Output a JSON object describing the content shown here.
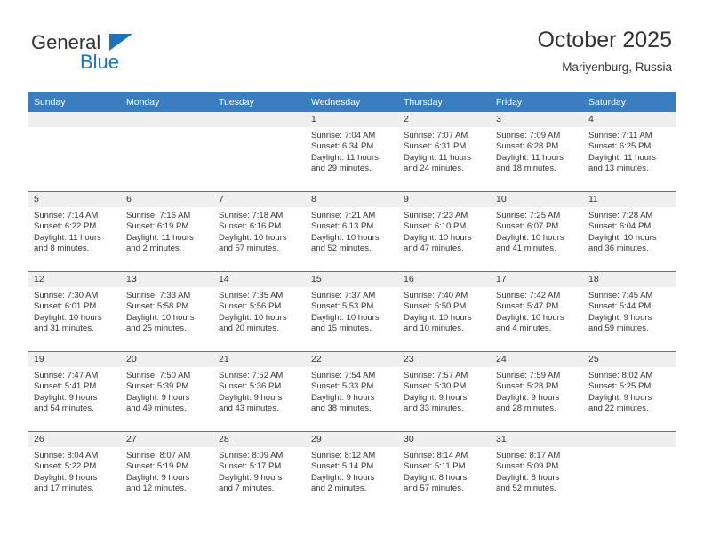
{
  "brand": {
    "name_top": "General",
    "name_bottom": "Blue",
    "accent_color": "#1b72bd",
    "triangle_icon": "triangle-right-icon"
  },
  "header": {
    "title": "October 2025",
    "subtitle": "Mariyenburg, Russia"
  },
  "theme": {
    "header_row_bg": "#3a7ebf",
    "daynum_band_bg": "#efefef",
    "text_color": "#333333",
    "row_divider": "#3a7ebf"
  },
  "weekdays": [
    "Sunday",
    "Monday",
    "Tuesday",
    "Wednesday",
    "Thursday",
    "Friday",
    "Saturday"
  ],
  "weeks": [
    [
      {
        "empty": true
      },
      {
        "empty": true
      },
      {
        "empty": true
      },
      {
        "day": "1",
        "sunrise": "Sunrise: 7:04 AM",
        "sunset": "Sunset: 6:34 PM",
        "daylight1": "Daylight: 11 hours",
        "daylight2": "and 29 minutes."
      },
      {
        "day": "2",
        "sunrise": "Sunrise: 7:07 AM",
        "sunset": "Sunset: 6:31 PM",
        "daylight1": "Daylight: 11 hours",
        "daylight2": "and 24 minutes."
      },
      {
        "day": "3",
        "sunrise": "Sunrise: 7:09 AM",
        "sunset": "Sunset: 6:28 PM",
        "daylight1": "Daylight: 11 hours",
        "daylight2": "and 18 minutes."
      },
      {
        "day": "4",
        "sunrise": "Sunrise: 7:11 AM",
        "sunset": "Sunset: 6:25 PM",
        "daylight1": "Daylight: 11 hours",
        "daylight2": "and 13 minutes."
      }
    ],
    [
      {
        "day": "5",
        "sunrise": "Sunrise: 7:14 AM",
        "sunset": "Sunset: 6:22 PM",
        "daylight1": "Daylight: 11 hours",
        "daylight2": "and 8 minutes."
      },
      {
        "day": "6",
        "sunrise": "Sunrise: 7:16 AM",
        "sunset": "Sunset: 6:19 PM",
        "daylight1": "Daylight: 11 hours",
        "daylight2": "and 2 minutes."
      },
      {
        "day": "7",
        "sunrise": "Sunrise: 7:18 AM",
        "sunset": "Sunset: 6:16 PM",
        "daylight1": "Daylight: 10 hours",
        "daylight2": "and 57 minutes."
      },
      {
        "day": "8",
        "sunrise": "Sunrise: 7:21 AM",
        "sunset": "Sunset: 6:13 PM",
        "daylight1": "Daylight: 10 hours",
        "daylight2": "and 52 minutes."
      },
      {
        "day": "9",
        "sunrise": "Sunrise: 7:23 AM",
        "sunset": "Sunset: 6:10 PM",
        "daylight1": "Daylight: 10 hours",
        "daylight2": "and 47 minutes."
      },
      {
        "day": "10",
        "sunrise": "Sunrise: 7:25 AM",
        "sunset": "Sunset: 6:07 PM",
        "daylight1": "Daylight: 10 hours",
        "daylight2": "and 41 minutes."
      },
      {
        "day": "11",
        "sunrise": "Sunrise: 7:28 AM",
        "sunset": "Sunset: 6:04 PM",
        "daylight1": "Daylight: 10 hours",
        "daylight2": "and 36 minutes."
      }
    ],
    [
      {
        "day": "12",
        "sunrise": "Sunrise: 7:30 AM",
        "sunset": "Sunset: 6:01 PM",
        "daylight1": "Daylight: 10 hours",
        "daylight2": "and 31 minutes."
      },
      {
        "day": "13",
        "sunrise": "Sunrise: 7:33 AM",
        "sunset": "Sunset: 5:58 PM",
        "daylight1": "Daylight: 10 hours",
        "daylight2": "and 25 minutes."
      },
      {
        "day": "14",
        "sunrise": "Sunrise: 7:35 AM",
        "sunset": "Sunset: 5:56 PM",
        "daylight1": "Daylight: 10 hours",
        "daylight2": "and 20 minutes."
      },
      {
        "day": "15",
        "sunrise": "Sunrise: 7:37 AM",
        "sunset": "Sunset: 5:53 PM",
        "daylight1": "Daylight: 10 hours",
        "daylight2": "and 15 minutes."
      },
      {
        "day": "16",
        "sunrise": "Sunrise: 7:40 AM",
        "sunset": "Sunset: 5:50 PM",
        "daylight1": "Daylight: 10 hours",
        "daylight2": "and 10 minutes."
      },
      {
        "day": "17",
        "sunrise": "Sunrise: 7:42 AM",
        "sunset": "Sunset: 5:47 PM",
        "daylight1": "Daylight: 10 hours",
        "daylight2": "and 4 minutes."
      },
      {
        "day": "18",
        "sunrise": "Sunrise: 7:45 AM",
        "sunset": "Sunset: 5:44 PM",
        "daylight1": "Daylight: 9 hours",
        "daylight2": "and 59 minutes."
      }
    ],
    [
      {
        "day": "19",
        "sunrise": "Sunrise: 7:47 AM",
        "sunset": "Sunset: 5:41 PM",
        "daylight1": "Daylight: 9 hours",
        "daylight2": "and 54 minutes."
      },
      {
        "day": "20",
        "sunrise": "Sunrise: 7:50 AM",
        "sunset": "Sunset: 5:39 PM",
        "daylight1": "Daylight: 9 hours",
        "daylight2": "and 49 minutes."
      },
      {
        "day": "21",
        "sunrise": "Sunrise: 7:52 AM",
        "sunset": "Sunset: 5:36 PM",
        "daylight1": "Daylight: 9 hours",
        "daylight2": "and 43 minutes."
      },
      {
        "day": "22",
        "sunrise": "Sunrise: 7:54 AM",
        "sunset": "Sunset: 5:33 PM",
        "daylight1": "Daylight: 9 hours",
        "daylight2": "and 38 minutes."
      },
      {
        "day": "23",
        "sunrise": "Sunrise: 7:57 AM",
        "sunset": "Sunset: 5:30 PM",
        "daylight1": "Daylight: 9 hours",
        "daylight2": "and 33 minutes."
      },
      {
        "day": "24",
        "sunrise": "Sunrise: 7:59 AM",
        "sunset": "Sunset: 5:28 PM",
        "daylight1": "Daylight: 9 hours",
        "daylight2": "and 28 minutes."
      },
      {
        "day": "25",
        "sunrise": "Sunrise: 8:02 AM",
        "sunset": "Sunset: 5:25 PM",
        "daylight1": "Daylight: 9 hours",
        "daylight2": "and 22 minutes."
      }
    ],
    [
      {
        "day": "26",
        "sunrise": "Sunrise: 8:04 AM",
        "sunset": "Sunset: 5:22 PM",
        "daylight1": "Daylight: 9 hours",
        "daylight2": "and 17 minutes."
      },
      {
        "day": "27",
        "sunrise": "Sunrise: 8:07 AM",
        "sunset": "Sunset: 5:19 PM",
        "daylight1": "Daylight: 9 hours",
        "daylight2": "and 12 minutes."
      },
      {
        "day": "28",
        "sunrise": "Sunrise: 8:09 AM",
        "sunset": "Sunset: 5:17 PM",
        "daylight1": "Daylight: 9 hours",
        "daylight2": "and 7 minutes."
      },
      {
        "day": "29",
        "sunrise": "Sunrise: 8:12 AM",
        "sunset": "Sunset: 5:14 PM",
        "daylight1": "Daylight: 9 hours",
        "daylight2": "and 2 minutes."
      },
      {
        "day": "30",
        "sunrise": "Sunrise: 8:14 AM",
        "sunset": "Sunset: 5:11 PM",
        "daylight1": "Daylight: 8 hours",
        "daylight2": "and 57 minutes."
      },
      {
        "day": "31",
        "sunrise": "Sunrise: 8:17 AM",
        "sunset": "Sunset: 5:09 PM",
        "daylight1": "Daylight: 8 hours",
        "daylight2": "and 52 minutes."
      },
      {
        "empty": true
      }
    ]
  ]
}
